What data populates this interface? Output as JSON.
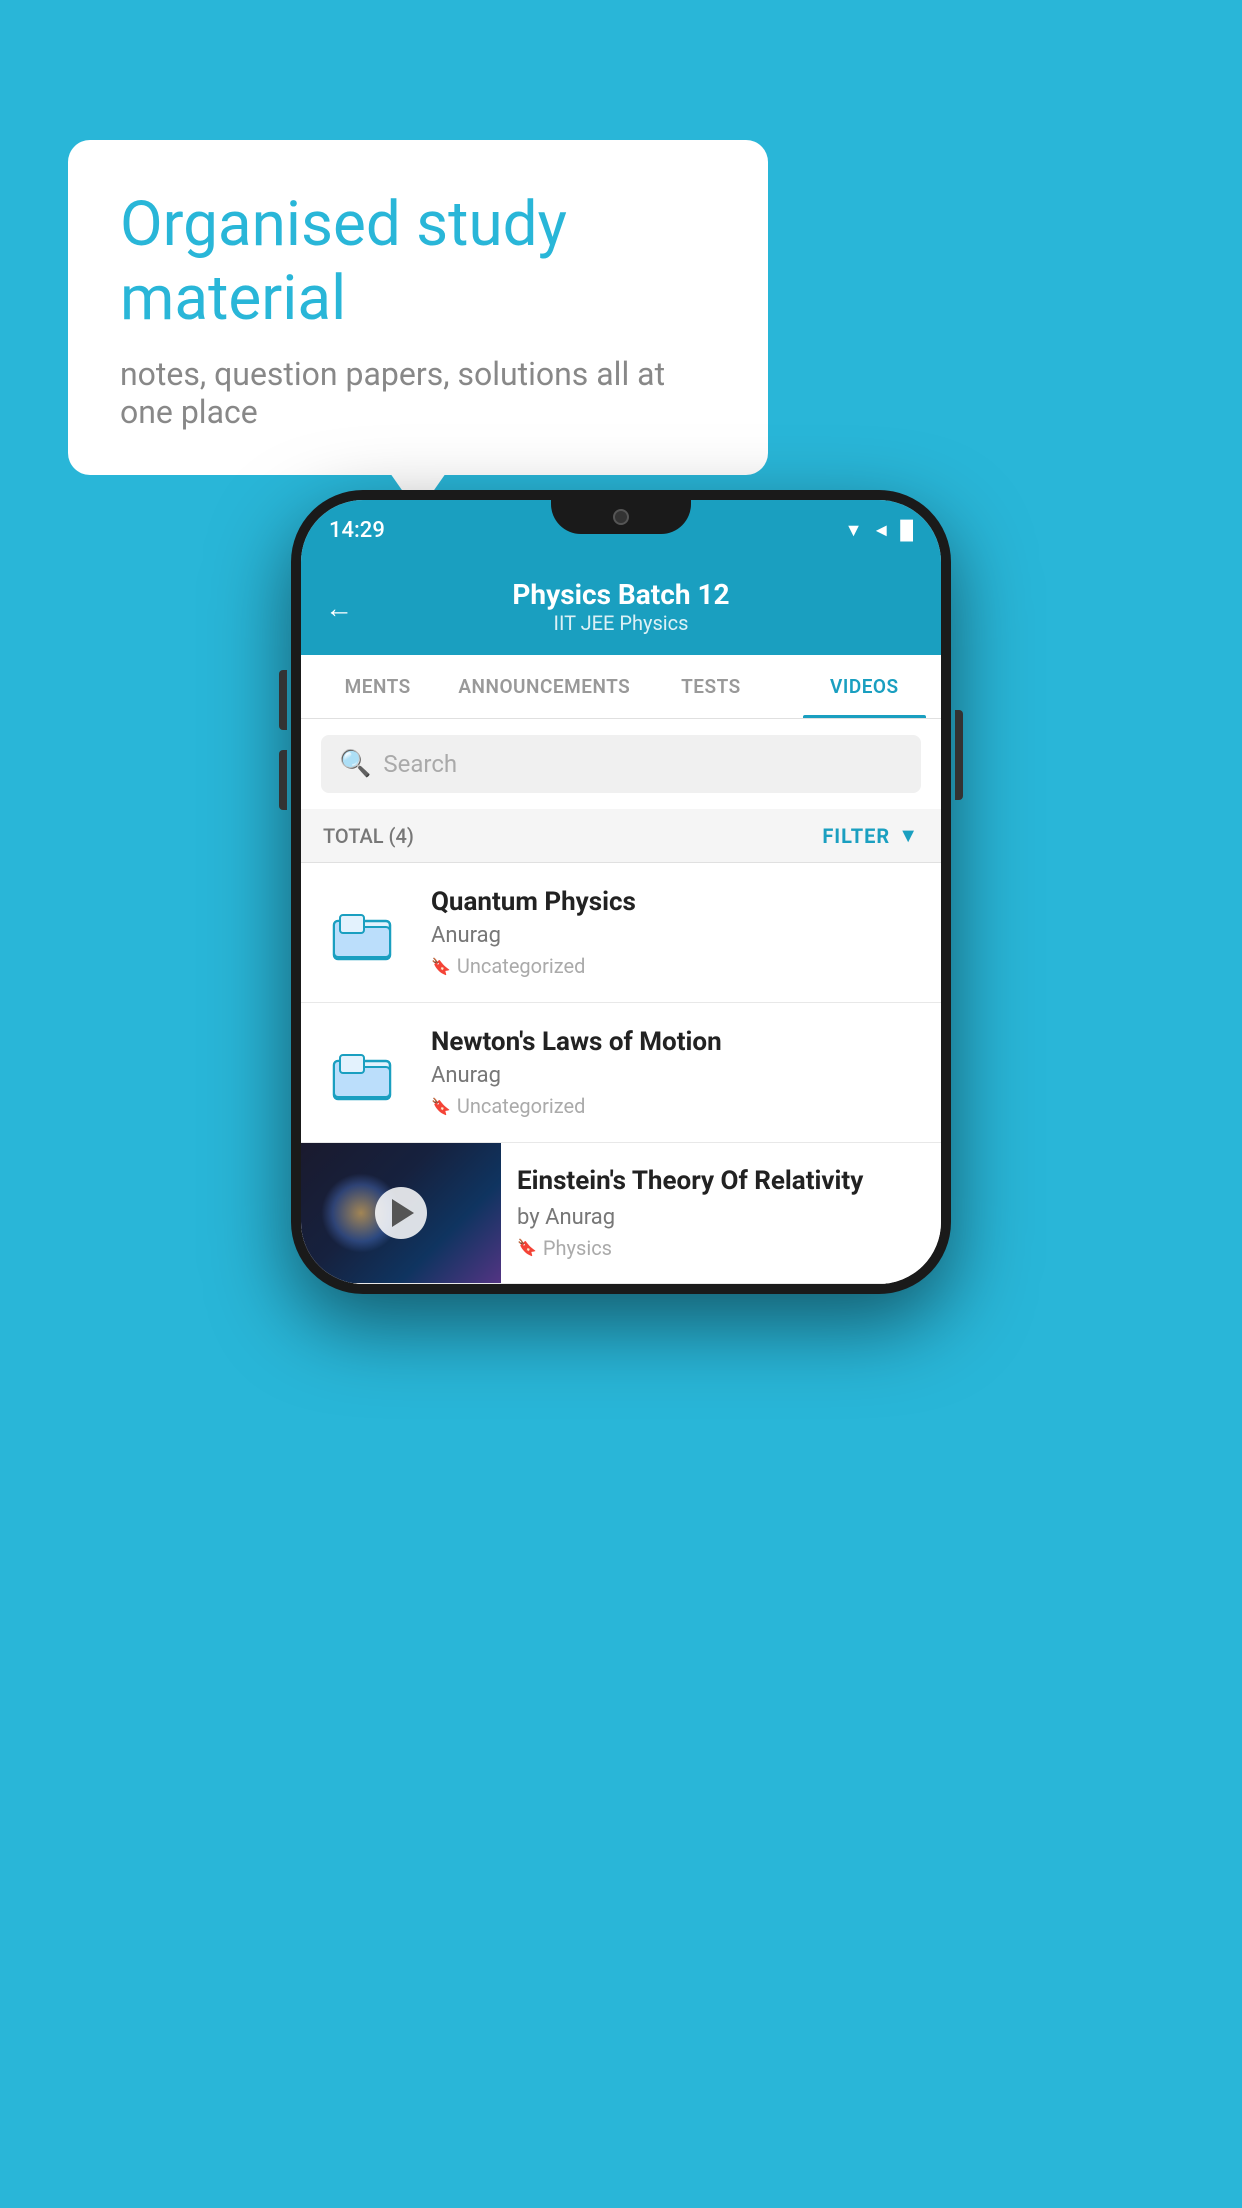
{
  "background": {
    "color": "#29b6d8"
  },
  "speechBubble": {
    "title": "Organised study material",
    "subtitle": "notes, question papers, solutions all at one place"
  },
  "phone": {
    "statusBar": {
      "time": "14:29",
      "icons": "▼◄█"
    },
    "header": {
      "back_label": "←",
      "title": "Physics Batch 12",
      "subtitle": "IIT JEE   Physics"
    },
    "tabs": [
      {
        "label": "MENTS",
        "active": false
      },
      {
        "label": "ANNOUNCEMENTS",
        "active": false
      },
      {
        "label": "TESTS",
        "active": false
      },
      {
        "label": "VIDEOS",
        "active": true
      }
    ],
    "search": {
      "placeholder": "Search"
    },
    "filter": {
      "total_label": "TOTAL (4)",
      "filter_label": "FILTER"
    },
    "videos": [
      {
        "title": "Quantum Physics",
        "author": "Anurag",
        "tag": "Uncategorized",
        "type": "folder"
      },
      {
        "title": "Newton's Laws of Motion",
        "author": "Anurag",
        "tag": "Uncategorized",
        "type": "folder"
      },
      {
        "title": "Einstein's Theory Of Relativity",
        "author": "by Anurag",
        "tag": "Physics",
        "type": "video"
      }
    ]
  }
}
